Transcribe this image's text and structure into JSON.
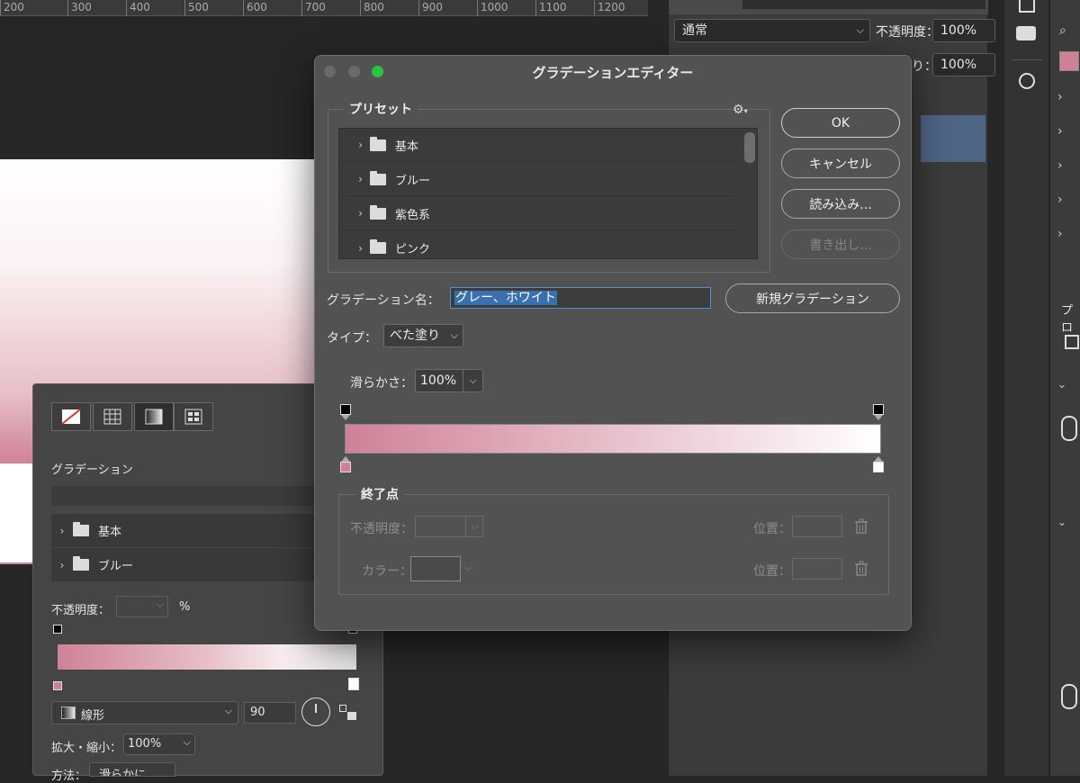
{
  "ruler": {
    "ticks": [
      "200",
      "300",
      "400",
      "500",
      "600",
      "700",
      "800",
      "900",
      "1000",
      "1100",
      "1200"
    ]
  },
  "right_panel": {
    "blend_mode": "通常",
    "opacity_label": "不透明度：",
    "opacity_value": "100%",
    "fill_label_partial": "り：",
    "fill_value": "100%",
    "properties_partial": "プロ"
  },
  "left_panel": {
    "section_title": "グラデーション",
    "folders": [
      {
        "label": "基本"
      },
      {
        "label": "ブルー"
      }
    ],
    "opacity_label": "不透明度：",
    "opacity_unit": "%",
    "gradient_type": "線形",
    "angle": "90",
    "scale_label": "拡大・縮小：",
    "scale_value": "100%",
    "method_label": "方法：",
    "method_value": "滑らかに"
  },
  "dialog": {
    "title": "グラデーションエディター",
    "presets": {
      "label": "プリセット",
      "items": [
        {
          "label": "基本"
        },
        {
          "label": "ブルー"
        },
        {
          "label": "紫色系"
        },
        {
          "label": "ピンク"
        }
      ]
    },
    "buttons": {
      "ok": "OK",
      "cancel": "キャンセル",
      "load": "読み込み...",
      "export": "書き出し...",
      "new_gradient": "新規グラデーション"
    },
    "name_label": "グラデーション名：",
    "name_value": "グレー、ホワイト",
    "type_label": "タイプ：",
    "type_value": "べた塗り",
    "smoothness_label": "滑らかさ：",
    "smoothness_value": "100%",
    "gradient_colors": {
      "start": "#cf8198",
      "end": "#ffffff"
    },
    "stops": {
      "label": "終了点",
      "opacity_label": "不透明度：",
      "position_label_1": "位置：",
      "color_label": "カラー：",
      "position_label_2": "位置："
    }
  }
}
